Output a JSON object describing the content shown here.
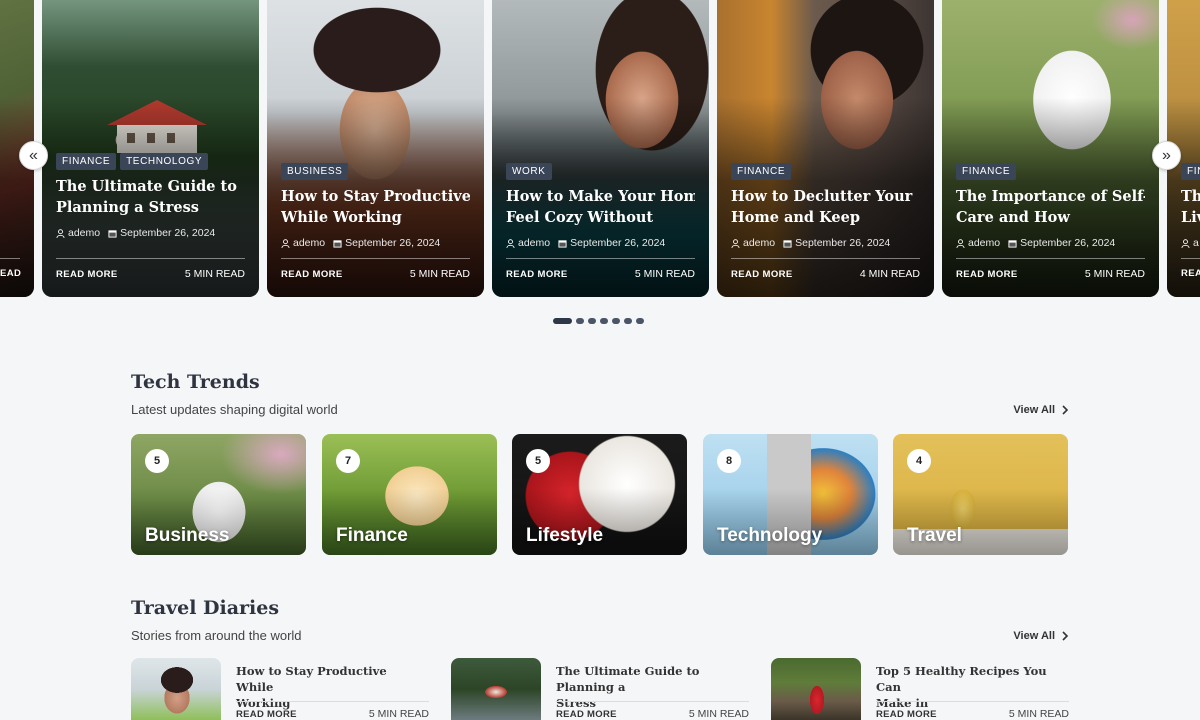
{
  "slider": {
    "cards": [
      {
        "tags": [],
        "title": "",
        "author": "",
        "date": "",
        "read_more": "EAD",
        "read_time": "",
        "theme": "partial-left"
      },
      {
        "tags": [
          "FINANCE",
          "TECHNOLOGY"
        ],
        "title_lines": [
          "The Ultimate Guide to",
          "Planning a Stress"
        ],
        "author": "ademo",
        "date": "September 26, 2024",
        "read_more": "READ MORE",
        "read_time": "5 MIN READ",
        "theme": "forest"
      },
      {
        "tags": [
          "BUSINESS"
        ],
        "title_lines": [
          "How to Stay Productive",
          "While Working"
        ],
        "author": "ademo",
        "date": "September 26, 2024",
        "read_more": "READ MORE",
        "read_time": "5 MIN READ",
        "theme": "hat"
      },
      {
        "tags": [
          "WORK"
        ],
        "title_lines": [
          "How to Make Your Home",
          "Feel Cozy Without"
        ],
        "author": "ademo",
        "date": "September 26, 2024",
        "read_more": "READ MORE",
        "read_time": "5 MIN READ",
        "theme": "car"
      },
      {
        "tags": [
          "FINANCE"
        ],
        "title_lines": [
          "How to Declutter Your",
          "Home and Keep"
        ],
        "author": "ademo",
        "date": "September 26, 2024",
        "read_more": "READ MORE",
        "read_time": "4 MIN READ",
        "theme": "window"
      },
      {
        "tags": [
          "FINANCE"
        ],
        "title_lines": [
          "The Importance of Self-",
          "Care and How"
        ],
        "author": "ademo",
        "date": "September 26, 2024",
        "read_more": "READ MORE",
        "read_time": "5 MIN READ",
        "theme": "dog"
      },
      {
        "tags": [
          "FIN"
        ],
        "title_lines": [
          "Th",
          "Liv"
        ],
        "author": "a",
        "date": "",
        "read_more": "REA",
        "read_time": "",
        "theme": "partial-right"
      }
    ],
    "prev_icon": "«",
    "next_icon": "»",
    "dots": 7
  },
  "tech": {
    "title": "Tech Trends",
    "subtitle": "Latest updates shaping digital world",
    "view_all": "View All",
    "categories": [
      {
        "count": "5",
        "name": "Business"
      },
      {
        "count": "7",
        "name": "Finance"
      },
      {
        "count": "5",
        "name": "Lifestyle"
      },
      {
        "count": "8",
        "name": "Technology"
      },
      {
        "count": "4",
        "name": "Travel"
      }
    ]
  },
  "travel": {
    "title": "Travel Diaries",
    "subtitle": "Stories from around the world",
    "view_all": "View All",
    "posts": [
      {
        "title_lines": [
          "How to Stay Productive While",
          "Working"
        ],
        "read_more": "READ MORE",
        "read_time": "5 MIN READ"
      },
      {
        "title_lines": [
          "The Ultimate Guide to Planning a",
          "Stress"
        ],
        "read_more": "READ MORE",
        "read_time": "5 MIN READ"
      },
      {
        "title_lines": [
          "Top 5 Healthy Recipes You Can",
          "Make in"
        ],
        "read_more": "READ MORE",
        "read_time": "5 MIN READ"
      }
    ]
  }
}
